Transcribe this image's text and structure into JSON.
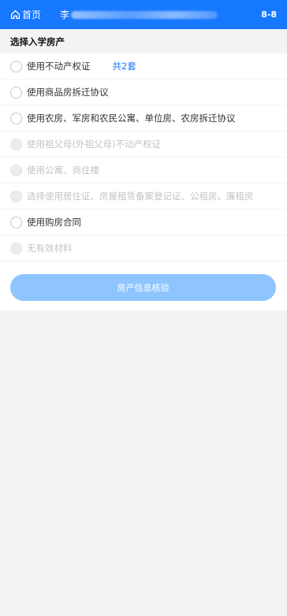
{
  "header": {
    "home_label": "首页",
    "user_name": "李",
    "corner_text": "8-8",
    "colors": {
      "bar": "#1677ff",
      "text": "#ffffff"
    }
  },
  "section": {
    "title": "选择入学房产"
  },
  "options": [
    {
      "label": "使用不动产权证",
      "extra": "共2套",
      "disabled": false
    },
    {
      "label": "使用商品房拆迁协议",
      "disabled": false
    },
    {
      "label": "使用农房、军房和农民公寓、单位房、农房拆迁协议",
      "disabled": false
    },
    {
      "label": "使用祖父母(外祖父母)不动产权证",
      "disabled": true
    },
    {
      "label": "使用公寓、商住楼",
      "disabled": true
    },
    {
      "label": "选择使用居住证、房屋租赁备案登记证、公租房、廉租房",
      "disabled": true
    },
    {
      "label": "使用购房合同",
      "disabled": false
    },
    {
      "label": "无有效材料",
      "disabled": true
    }
  ],
  "submit": {
    "label": "房产信息核验",
    "color": "#8ec5ff"
  },
  "icons": {
    "home": "home-icon",
    "radio": "radio-circle-icon"
  }
}
